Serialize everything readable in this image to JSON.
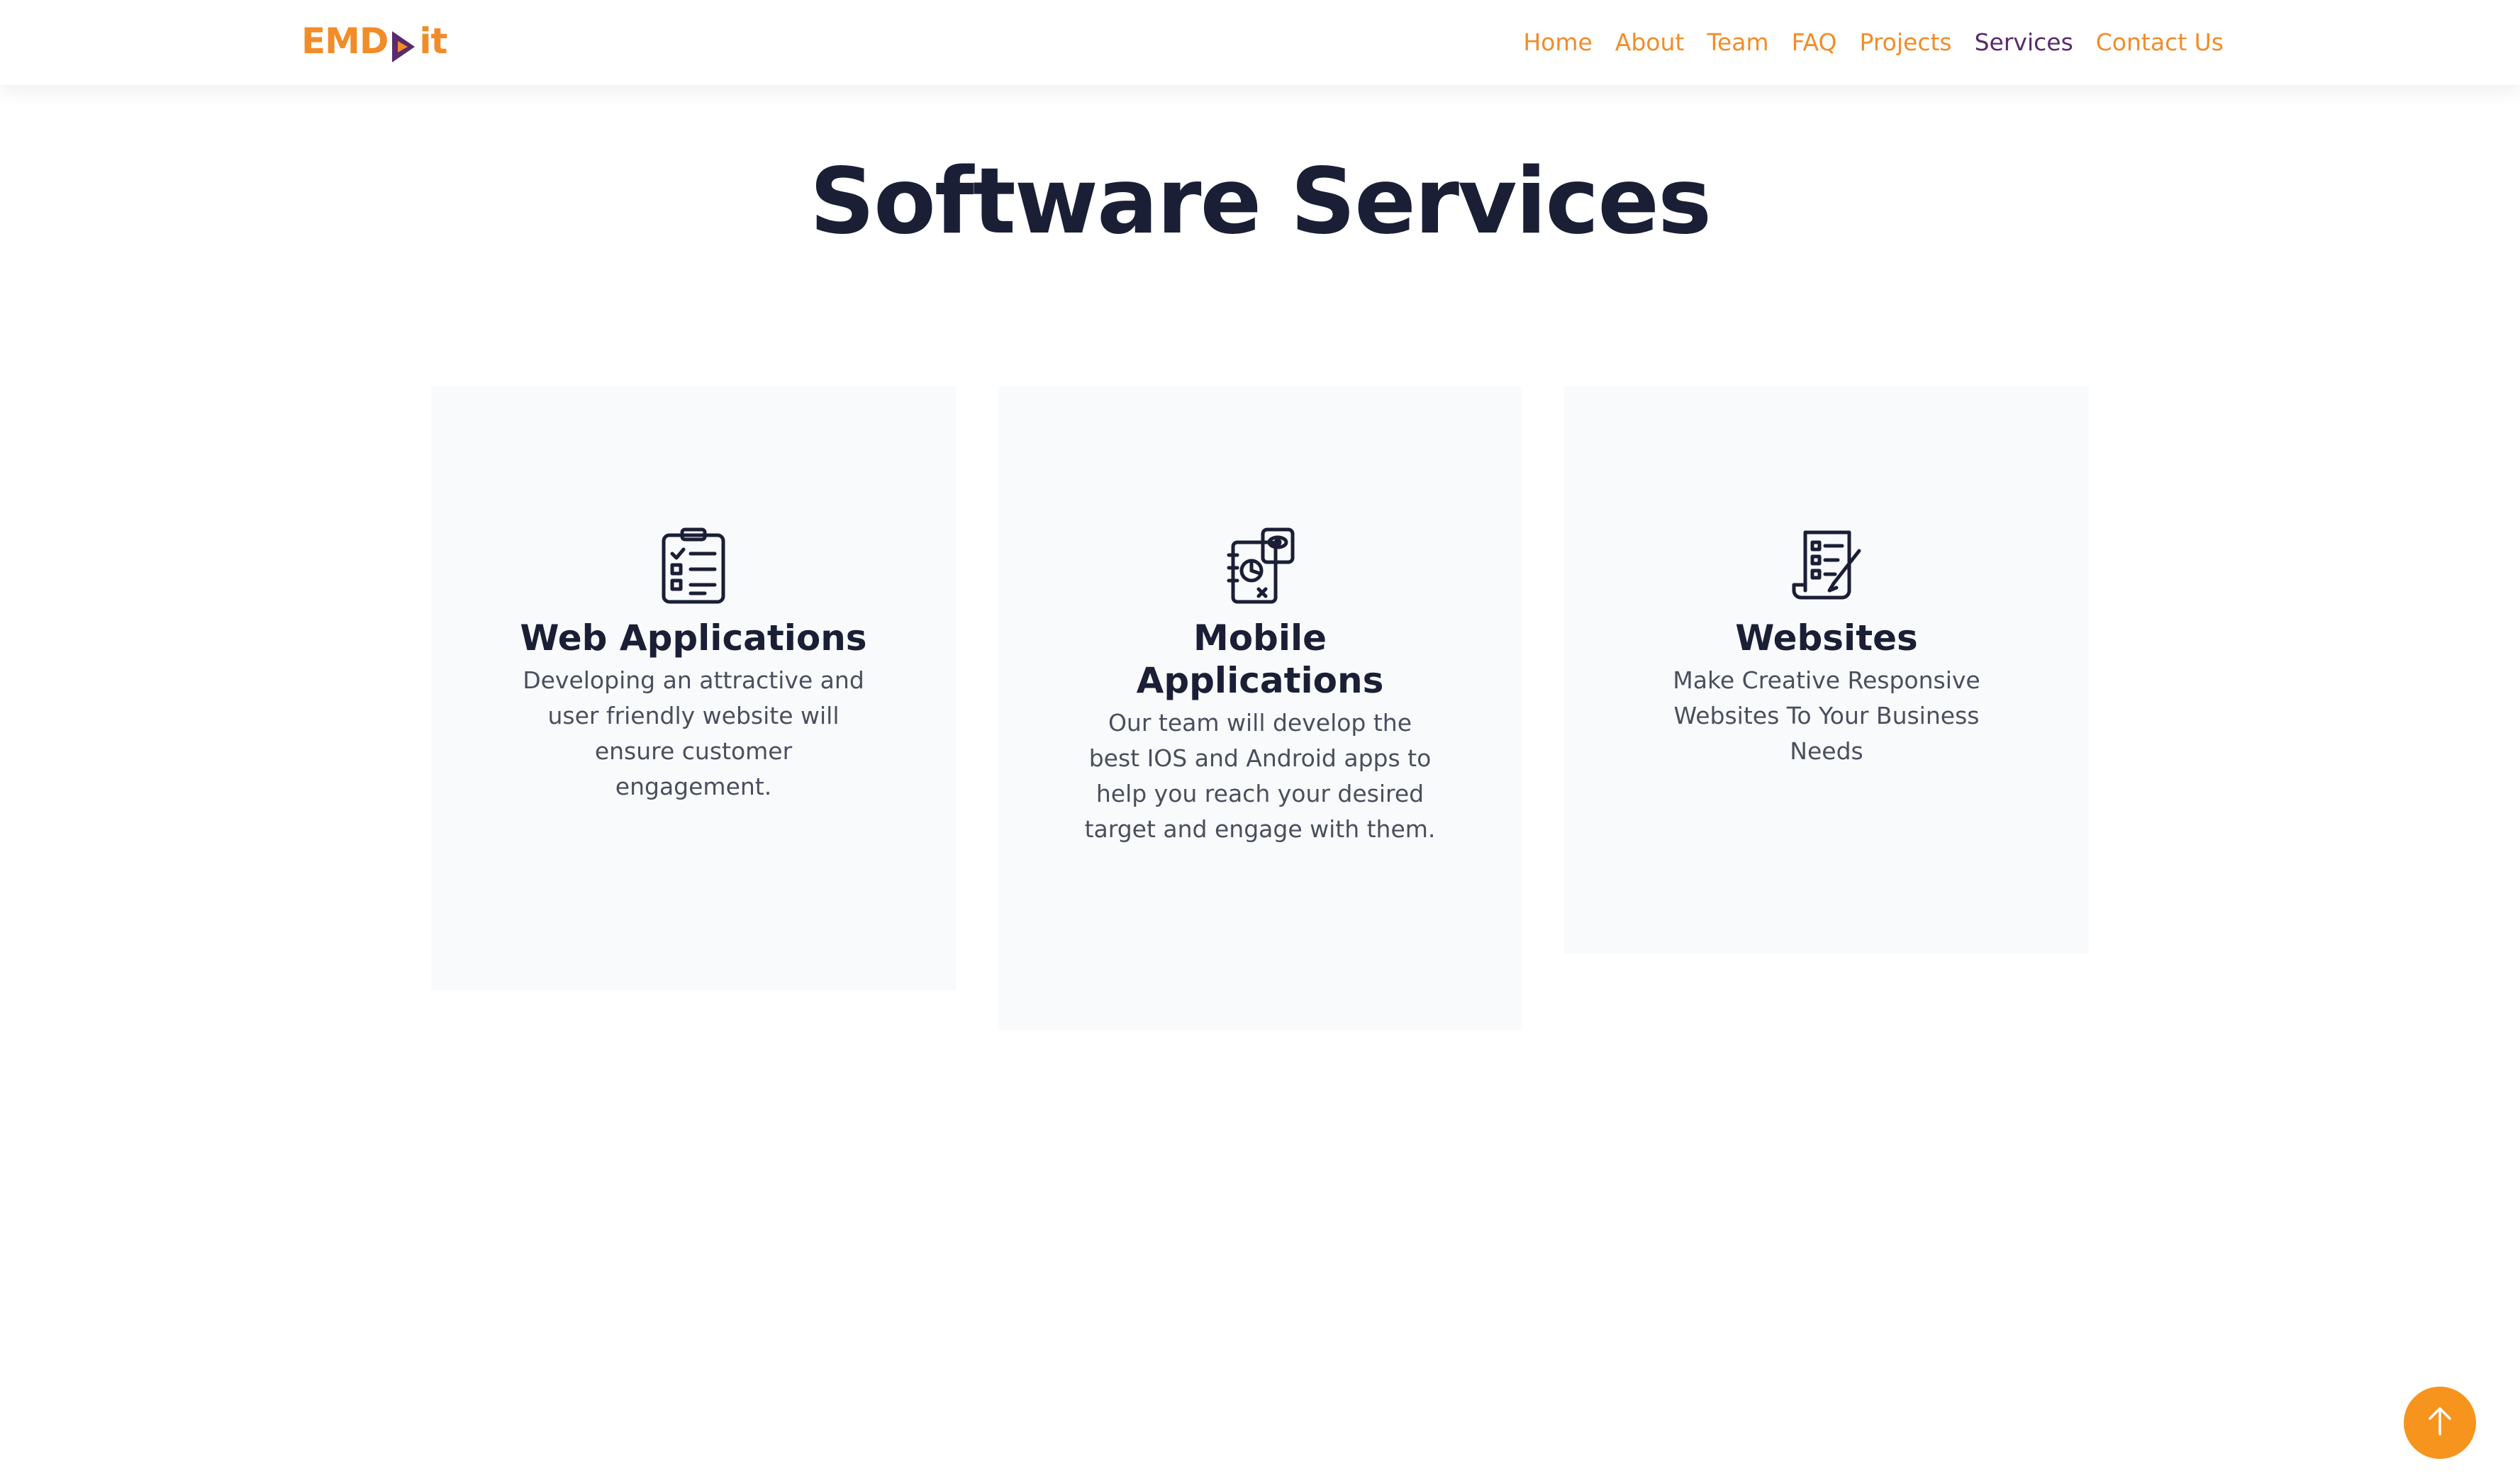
{
  "header": {
    "logo_left": "EMD",
    "logo_right": "it",
    "nav": [
      {
        "label": "Home",
        "active": false
      },
      {
        "label": "About",
        "active": false
      },
      {
        "label": "Team",
        "active": false
      },
      {
        "label": "FAQ",
        "active": false
      },
      {
        "label": "Projects",
        "active": false
      },
      {
        "label": "Services",
        "active": true
      },
      {
        "label": "Contact Us",
        "active": false
      }
    ]
  },
  "main": {
    "title": "Software Services",
    "cards": [
      {
        "icon": "checklist-clipboard-icon",
        "title": "Web Applications",
        "description": "Developing an attractive and user friendly website will ensure customer engagement."
      },
      {
        "icon": "mobile-notebook-eye-icon",
        "title": "Mobile Applications",
        "description": "Our team will develop the best IOS and Android apps to help you reach your desired target and engage with them."
      },
      {
        "icon": "document-pen-icon",
        "title": "Websites",
        "description": "Make Creative Responsive Websites To Your Business Needs"
      }
    ]
  },
  "scroll_top": {
    "icon": "arrow-up-icon"
  },
  "colors": {
    "accent": "#f28c28",
    "active_nav": "#5a2a6a",
    "heading": "#1a1f36",
    "body_text": "#4a4f5e",
    "card_bg": "#f9fafc",
    "scroll_button": "#f7941d"
  }
}
